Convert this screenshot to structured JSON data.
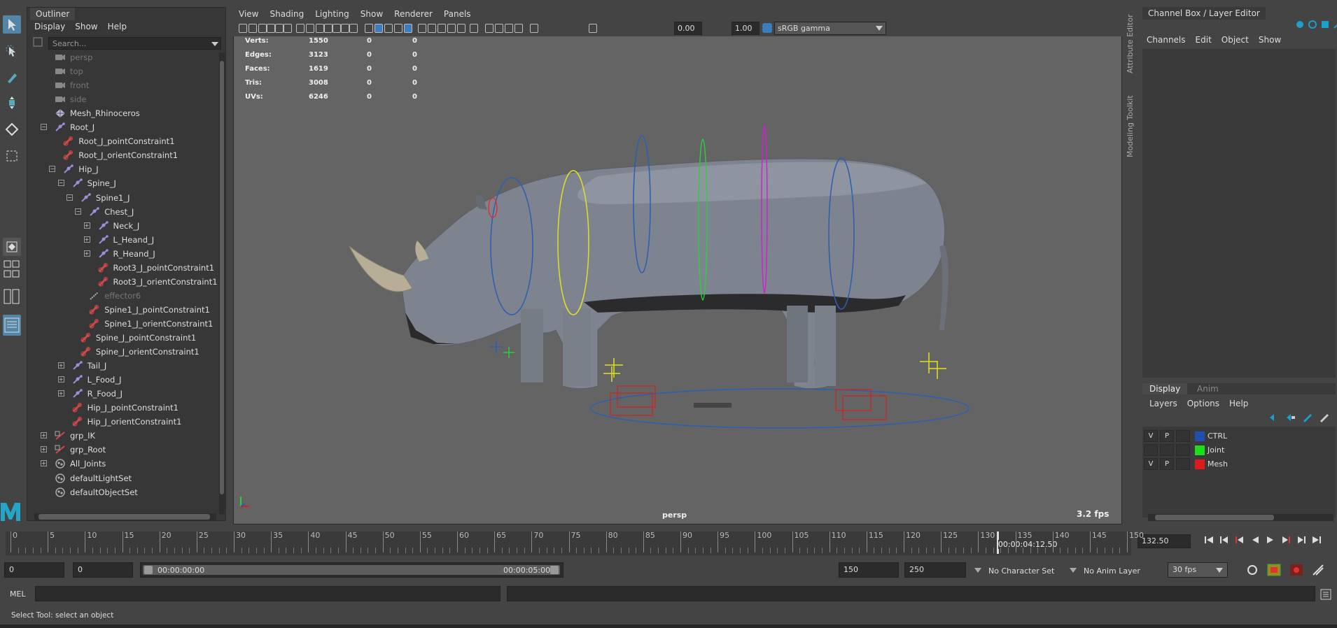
{
  "outliner": {
    "tab": "Outliner",
    "menus": [
      "Display",
      "Show",
      "Help"
    ],
    "search_placeholder": "Search...",
    "items": [
      {
        "label": "persp",
        "grey": true,
        "icon": "camera-icon",
        "level": 0
      },
      {
        "label": "top",
        "grey": true,
        "icon": "camera-icon",
        "level": 0
      },
      {
        "label": "front",
        "grey": true,
        "icon": "camera-icon",
        "level": 0
      },
      {
        "label": "side",
        "grey": true,
        "icon": "camera-icon",
        "level": 0
      },
      {
        "label": "Mesh_Rhinoceros",
        "icon": "mesh-icon",
        "level": 0
      },
      {
        "label": "Root_J",
        "icon": "joint-icon",
        "level": 0,
        "expander": "-"
      },
      {
        "label": "Root_J_pointConstraint1",
        "icon": "constraint-icon",
        "level": 1
      },
      {
        "label": "Root_J_orientConstraint1",
        "icon": "constraint-icon",
        "level": 1
      },
      {
        "label": "Hip_J",
        "icon": "joint-icon",
        "level": 1,
        "expander": "-"
      },
      {
        "label": "Spine_J",
        "icon": "joint-icon",
        "level": 2,
        "expander": "-"
      },
      {
        "label": "Spine1_J",
        "icon": "joint-icon",
        "level": 3,
        "expander": "-"
      },
      {
        "label": "Chest_J",
        "icon": "joint-icon",
        "level": 4,
        "expander": "-"
      },
      {
        "label": "Neck_J",
        "icon": "joint-icon",
        "level": 5,
        "expander": "+"
      },
      {
        "label": "L_Heand_J",
        "icon": "joint-icon",
        "level": 5,
        "expander": "+"
      },
      {
        "label": "R_Heand_J",
        "icon": "joint-icon",
        "level": 5,
        "expander": "+"
      },
      {
        "label": "Root3_J_pointConstraint1",
        "icon": "constraint-icon",
        "level": 5
      },
      {
        "label": "Root3_J_orientConstraint1",
        "icon": "constraint-icon",
        "level": 5
      },
      {
        "label": "effector6",
        "grey": true,
        "icon": "effector-icon",
        "level": 4
      },
      {
        "label": "Spine1_J_pointConstraint1",
        "icon": "constraint-icon",
        "level": 4
      },
      {
        "label": "Spine1_J_orientConstraint1",
        "icon": "constraint-icon",
        "level": 4
      },
      {
        "label": "Spine_J_pointConstraint1",
        "icon": "constraint-icon",
        "level": 3
      },
      {
        "label": "Spine_J_orientConstraint1",
        "icon": "constraint-icon",
        "level": 3
      },
      {
        "label": "Tail_J",
        "icon": "joint-icon",
        "level": 2,
        "expander": "+"
      },
      {
        "label": "L_Food_J",
        "icon": "joint-icon",
        "level": 2,
        "expander": "+"
      },
      {
        "label": "R_Food_J",
        "icon": "joint-icon",
        "level": 2,
        "expander": "+"
      },
      {
        "label": "Hip_J_pointConstraint1",
        "icon": "constraint-icon",
        "level": 2
      },
      {
        "label": "Hip_J_orientConstraint1",
        "icon": "constraint-icon",
        "level": 2
      },
      {
        "label": "grp_IK",
        "icon": "group-icon",
        "level": 0,
        "expander": "+"
      },
      {
        "label": "grp_Root",
        "icon": "group-icon",
        "level": 0,
        "expander": "+"
      },
      {
        "label": "All_Joints",
        "icon": "set-icon",
        "level": 0,
        "expander": "+"
      },
      {
        "label": "defaultLightSet",
        "icon": "set-icon",
        "level": 0
      },
      {
        "label": "defaultObjectSet",
        "icon": "set-icon",
        "level": 0
      }
    ]
  },
  "viewport": {
    "menus": [
      "View",
      "Shading",
      "Lighting",
      "Show",
      "Renderer",
      "Panels"
    ],
    "exposure": "0.00",
    "gamma": "1.00",
    "color_space": "sRGB gamma",
    "hud": [
      {
        "label": "Verts:",
        "v1": "1550",
        "v2": "0",
        "v3": "0"
      },
      {
        "label": "Edges:",
        "v1": "3123",
        "v2": "0",
        "v3": "0"
      },
      {
        "label": "Faces:",
        "v1": "1619",
        "v2": "0",
        "v3": "0"
      },
      {
        "label": "Tris:",
        "v1": "3008",
        "v2": "0",
        "v3": "0"
      },
      {
        "label": "UVs:",
        "v1": "6246",
        "v2": "0",
        "v3": "0"
      }
    ],
    "camera": "persp",
    "fps": "3.2 fps"
  },
  "channel_box": {
    "title": "Channel Box / Layer Editor",
    "menus": [
      "Channels",
      "Edit",
      "Object",
      "Show"
    ],
    "tabs": [
      "Display",
      "Anim"
    ],
    "layer_menus": [
      "Layers",
      "Options",
      "Help"
    ],
    "layers": [
      {
        "v": "V",
        "p": "P",
        "name": "CTRL",
        "color": "#1f4fb0"
      },
      {
        "v": "",
        "p": "",
        "name": "Joint",
        "color": "#19e019"
      },
      {
        "v": "V",
        "p": "P",
        "name": "Mesh",
        "color": "#e01919"
      }
    ]
  },
  "side_tabs": [
    "Attribute Editor",
    "Modeling Toolkit"
  ],
  "timeline": {
    "labels": [
      "0",
      "5",
      "10",
      "15",
      "20",
      "25",
      "30",
      "35",
      "40",
      "45",
      "50",
      "55",
      "60",
      "65",
      "70",
      "75",
      "80",
      "85",
      "90",
      "95",
      "100",
      "105",
      "110",
      "115",
      "120",
      "125",
      "130",
      "135",
      "140",
      "145",
      "150"
    ],
    "current_time": "00:00:04:12.50",
    "current_frame": "132.50",
    "current_fraction": 0.8833
  },
  "range": {
    "start": "0",
    "playback_start": "0",
    "range_start_time": "00:00:00:00",
    "range_end_time": "00:00:05:00",
    "playback_end": "150",
    "end": "250",
    "character_set": "No Character Set",
    "anim_layer": "No Anim Layer",
    "fps": "30 fps"
  },
  "command": {
    "lang": "MEL"
  },
  "status": {
    "text": "Select Tool: select an object"
  }
}
